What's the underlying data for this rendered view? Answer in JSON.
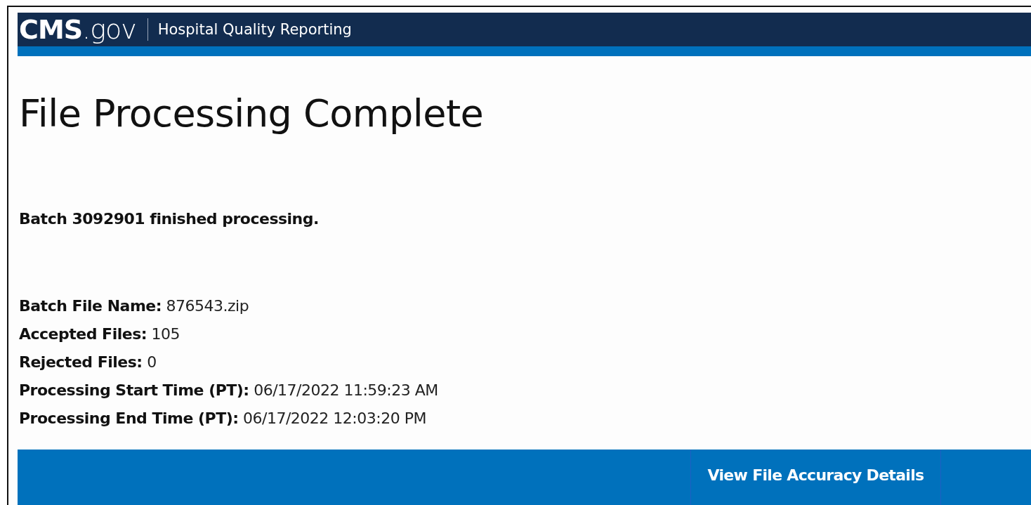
{
  "header": {
    "logo": "**CMS**.gov",
    "site_name": "Hospital Quality Reporting"
  },
  "page_title": "File Processing Complete",
  "message": "Batch 3092901 finished processing.",
  "details": [
    {
      "label": "Batch File Name:",
      "value": "876543.zip"
    },
    {
      "label": "Accepted Files:",
      "value": "105"
    },
    {
      "label": "Rejected Files:",
      "value": "0"
    },
    {
      "label": "Processing Start Time (PT):",
      "value": "06/17/2022 11:59:23 AM"
    },
    {
      "label": "Processing End Time (PT):",
      "value": "06/17/2022 12:03:20 PM"
    }
  ],
  "action_bar": {
    "button": "View File Accuracy Details"
  }
}
